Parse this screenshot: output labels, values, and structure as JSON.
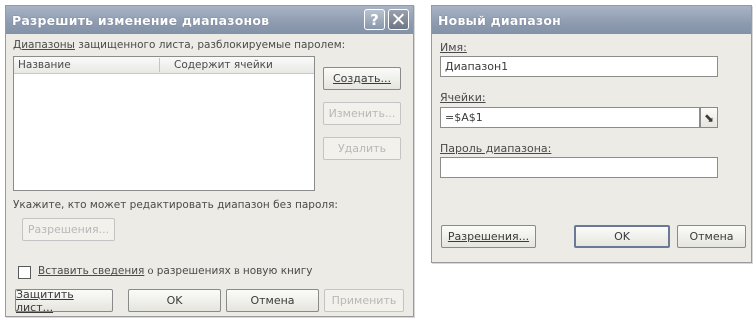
{
  "dialog1": {
    "title": "Разрешить изменение диапазонов",
    "help_glyph": "?",
    "close_glyph": "✕",
    "ranges_label_pre": "Диапазоны",
    "ranges_label_post": " защищенного листа, разблокируемые паролем:",
    "columns": [
      "Название",
      "Содержит ячейки"
    ],
    "create_button": "Создать...",
    "edit_button": "Изменить...",
    "delete_button": "Удалить",
    "who_can_edit_label": "Укажите, кто может редактировать диапазон без пароля:",
    "permissions_button": "Разрешения...",
    "checkbox_part1": "Вставить сведения",
    "checkbox_part2": " о ",
    "checkbox_part3": "разрешениях",
    "checkbox_part4": " в ",
    "checkbox_part5": "новую книгу",
    "protect_sheet_button": "Защитить лист...",
    "ok_button": "OK",
    "cancel_button": "Отмена",
    "apply_button": "Применить"
  },
  "dialog2": {
    "title": "Новый диапазон",
    "name_label": "Имя:",
    "name_value": "Диапазон1",
    "cells_label": "Ячейки:",
    "cells_value": "=$A$1",
    "range_picker_glyph": "⬊",
    "password_label": "Пароль диапазона:",
    "password_value": "",
    "permissions_button": "Разрешения...",
    "ok_button": "OK",
    "cancel_button": "Отмена"
  }
}
